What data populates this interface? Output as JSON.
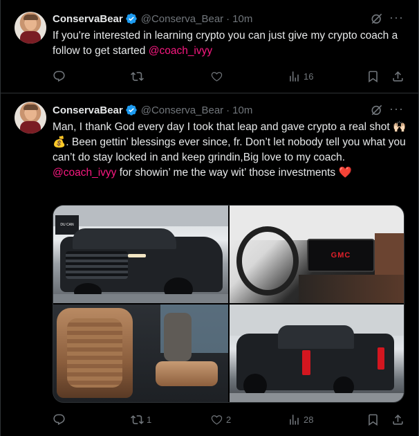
{
  "colors": {
    "background": "#000000",
    "text": "#e7e9ea",
    "muted": "#71767b",
    "mention": "#f91880",
    "verified": "#1d9bf0",
    "border": "#2f3336",
    "heart": "#f91880"
  },
  "tweets": [
    {
      "author": {
        "name": "ConservaBear",
        "handle": "@Conserva_Bear",
        "verified_icon": "verified-badge-icon",
        "avatar_icon": "profile-avatar"
      },
      "separator": "·",
      "time": "10m",
      "more_label": "···",
      "text_before": "If you're interested in learning crypto you can just give my crypto coach a follow to get started ",
      "mention": "@coach_ivyy",
      "text_after": "",
      "actions": {
        "reply": {
          "icon": "reply-icon",
          "count": ""
        },
        "repost": {
          "icon": "repost-icon",
          "count": ""
        },
        "like": {
          "icon": "heart-icon",
          "count": ""
        },
        "views": {
          "icon": "views-icon",
          "count": "16"
        },
        "bookmark": {
          "icon": "bookmark-icon"
        },
        "share": {
          "icon": "share-icon"
        }
      }
    },
    {
      "author": {
        "name": "ConservaBear",
        "handle": "@Conserva_Bear",
        "verified_icon": "verified-badge-icon",
        "avatar_icon": "profile-avatar"
      },
      "separator": "·",
      "time": "10m",
      "more_label": "···",
      "text_before": "Man, I thank God every day I took that leap and gave crypto a real shot 🙌🏻💰. Been gettin’ blessings ever since, fr. Don’t let nobody tell you what you can’t do stay locked in and keep grindin,Big love to my coach. ",
      "mention": "@coach_ivyy",
      "text_after": " for showin’ me the way wit’ those investments ❤️",
      "media": [
        {
          "icon": "truck-front-photo"
        },
        {
          "icon": "truck-dashboard-photo",
          "text": "GMC"
        },
        {
          "icon": "leather-seat-photo"
        },
        {
          "icon": "truck-rear-photo"
        }
      ],
      "media_text": {
        "banner": "DU CAN TRUST"
      },
      "actions": {
        "reply": {
          "icon": "reply-icon",
          "count": ""
        },
        "repost": {
          "icon": "repost-icon",
          "count": "1"
        },
        "like": {
          "icon": "heart-icon",
          "count": "2"
        },
        "views": {
          "icon": "views-icon",
          "count": "28"
        },
        "bookmark": {
          "icon": "bookmark-icon"
        },
        "share": {
          "icon": "share-icon"
        }
      }
    }
  ]
}
